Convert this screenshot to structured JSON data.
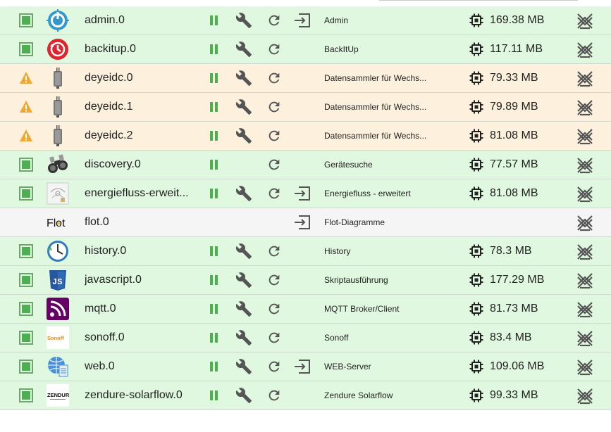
{
  "instances": [
    {
      "status": "ok",
      "name": "admin.0",
      "logo": "admin-logo-icon",
      "has_pause": true,
      "has_config": true,
      "has_open": true,
      "title": "Admin",
      "memory": "169.38 MB"
    },
    {
      "status": "ok",
      "name": "backitup.0",
      "logo": "backitup-logo-icon",
      "has_pause": true,
      "has_config": true,
      "has_open": false,
      "title": "BackItUp",
      "memory": "117.11 MB"
    },
    {
      "status": "warn",
      "name": "deyeidc.0",
      "logo": "deyeidc-logo-icon",
      "has_pause": true,
      "has_config": true,
      "has_open": false,
      "title": "Datensammler für Wechs...",
      "memory": "79.33 MB"
    },
    {
      "status": "warn",
      "name": "deyeidc.1",
      "logo": "deyeidc-logo-icon",
      "has_pause": true,
      "has_config": true,
      "has_open": false,
      "title": "Datensammler für Wechs...",
      "memory": "79.89 MB"
    },
    {
      "status": "warn",
      "name": "deyeidc.2",
      "logo": "deyeidc-logo-icon",
      "has_pause": true,
      "has_config": true,
      "has_open": false,
      "title": "Datensammler für Wechs...",
      "memory": "81.08 MB"
    },
    {
      "status": "ok",
      "name": "discovery.0",
      "logo": "binoculars-logo-icon",
      "has_pause": true,
      "has_config": false,
      "has_open": false,
      "title": "Gerätesuche",
      "memory": "77.57 MB"
    },
    {
      "status": "ok",
      "name": "energiefluss-erweit...",
      "logo": "energiefluss-logo-icon",
      "has_pause": true,
      "has_config": true,
      "has_open": true,
      "title": "Energiefluss - erweitert",
      "memory": "81.08 MB"
    },
    {
      "status": "off",
      "name": "flot.0",
      "logo": "flot-logo-icon",
      "logo_text": "Flot",
      "has_pause": false,
      "has_config": false,
      "has_open": true,
      "title": "Flot-Diagramme",
      "memory": ""
    },
    {
      "status": "ok",
      "name": "history.0",
      "logo": "history-logo-icon",
      "has_pause": true,
      "has_config": true,
      "has_open": false,
      "title": "History",
      "memory": "78.3 MB"
    },
    {
      "status": "ok",
      "name": "javascript.0",
      "logo": "js-logo-icon",
      "has_pause": true,
      "has_config": true,
      "has_open": false,
      "title": "Skriptausführung",
      "memory": "177.29 MB"
    },
    {
      "status": "ok",
      "name": "mqtt.0",
      "logo": "mqtt-logo-icon",
      "has_pause": true,
      "has_config": true,
      "has_open": false,
      "title": "MQTT Broker/Client",
      "memory": "81.73 MB"
    },
    {
      "status": "ok",
      "name": "sonoff.0",
      "logo": "sonoff-logo-icon",
      "logo_text": "Sonoff",
      "has_pause": true,
      "has_config": true,
      "has_open": false,
      "title": "Sonoff",
      "memory": "83.4 MB"
    },
    {
      "status": "ok",
      "name": "web.0",
      "logo": "web-logo-icon",
      "has_pause": true,
      "has_config": true,
      "has_open": true,
      "title": "WEB-Server",
      "memory": "109.06 MB"
    },
    {
      "status": "ok",
      "name": "zendure-solarflow.0",
      "logo": "zendure-logo-icon",
      "logo_text": "ZENDURE",
      "has_pause": true,
      "has_config": true,
      "has_open": false,
      "title": "Zendure Solarflow",
      "memory": "99.33 MB"
    }
  ],
  "colors": {
    "row_ok": "#dff8df",
    "row_warn": "#fdf1dd",
    "row_off": "#f5f5f5",
    "status_green": "#4caf50",
    "warning_orange": "#f0a830",
    "icon_gray": "#555555"
  }
}
